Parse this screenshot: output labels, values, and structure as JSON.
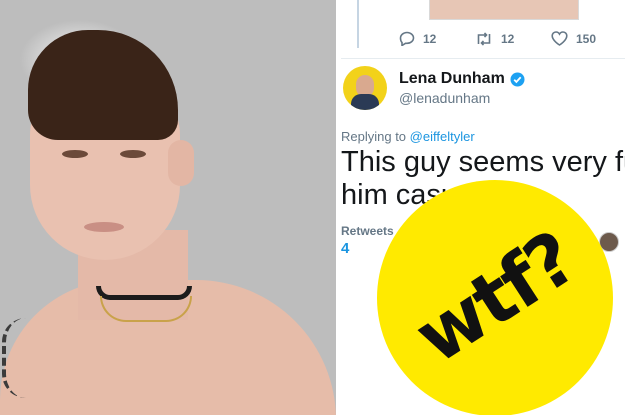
{
  "tweet": {
    "stats": {
      "replies": "12",
      "retweets": "12",
      "likes": "150"
    },
    "author_name": "Lena Dunham",
    "author_handle": "@lenadunham",
    "replying_prefix": "Replying to",
    "replying_to": "@eiffeltyler",
    "text_line1": "This guy seems very fu",
    "text_line2": "him casually",
    "retweets_label": "Retweets",
    "retweets_value": "4"
  },
  "sticker": {
    "text": "wtf?"
  },
  "colors": {
    "accent": "#1b95e0",
    "verified": "#1da1f2",
    "sticker": "#ffea00"
  },
  "icons": [
    "reply-icon",
    "retweet-icon",
    "like-icon",
    "verified-icon"
  ]
}
